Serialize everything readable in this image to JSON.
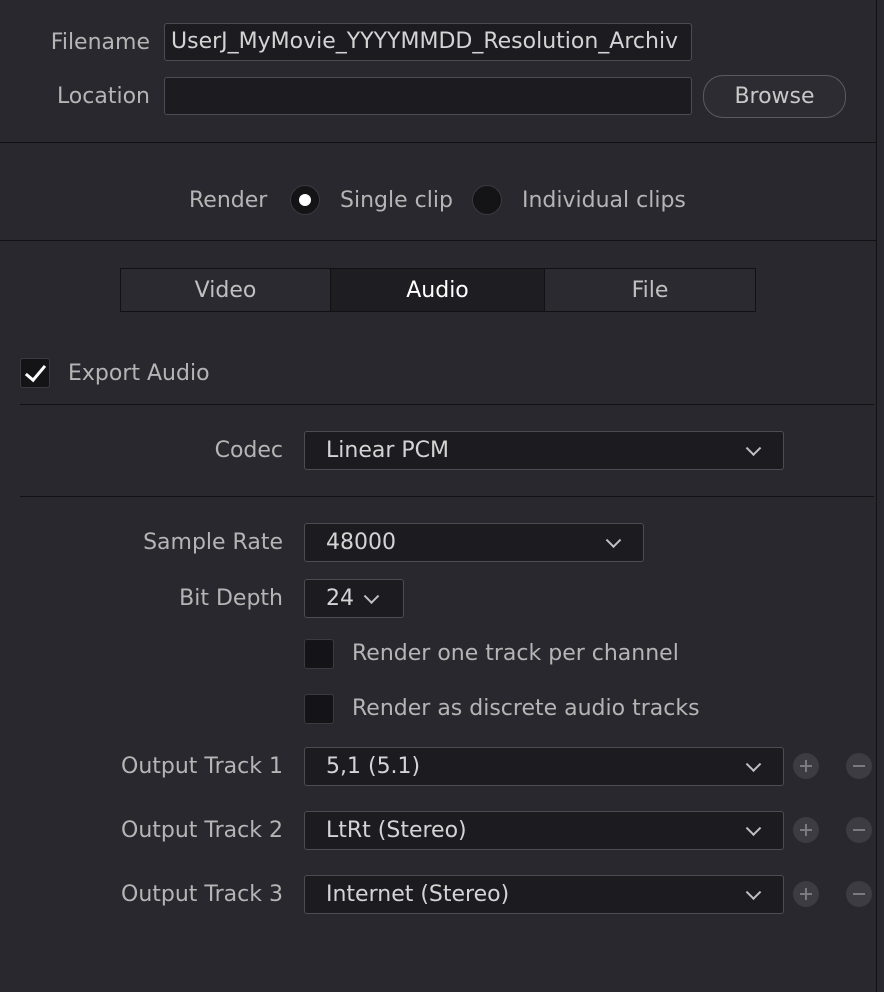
{
  "file": {
    "filename_label": "Filename",
    "filename_value": "UserJ_MyMovie_YYYYMMDD_Resolution_Archiv",
    "location_label": "Location",
    "location_value": "",
    "browse_label": "Browse"
  },
  "render": {
    "label": "Render",
    "options": [
      {
        "label": "Single clip",
        "selected": true
      },
      {
        "label": "Individual clips",
        "selected": false
      }
    ]
  },
  "tabs": [
    {
      "label": "Video",
      "active": false
    },
    {
      "label": "Audio",
      "active": true
    },
    {
      "label": "File",
      "active": false
    }
  ],
  "audio": {
    "export_audio_label": "Export Audio",
    "export_audio_checked": true,
    "codec_label": "Codec",
    "codec_value": "Linear PCM",
    "sample_rate_label": "Sample Rate",
    "sample_rate_value": "48000",
    "bit_depth_label": "Bit Depth",
    "bit_depth_value": "24",
    "one_track_label": "Render one track per channel",
    "one_track_checked": false,
    "discrete_label": "Render as discrete audio tracks",
    "discrete_checked": false,
    "output_tracks": [
      {
        "label": "Output Track 1",
        "value": "5,1 (5.1)"
      },
      {
        "label": "Output Track 2",
        "value": "LtRt (Stereo)"
      },
      {
        "label": "Output Track 3",
        "value": "Internet (Stereo)"
      }
    ]
  },
  "icons": {
    "add": "plus-icon",
    "remove": "minus-icon",
    "dropdown": "chevron-down-icon",
    "check": "checkmark-icon"
  },
  "colors": {
    "background": "#28282e",
    "field_background": "#1c1c20",
    "active_tab": "#1e1e22",
    "text": "#b5b5b5"
  }
}
